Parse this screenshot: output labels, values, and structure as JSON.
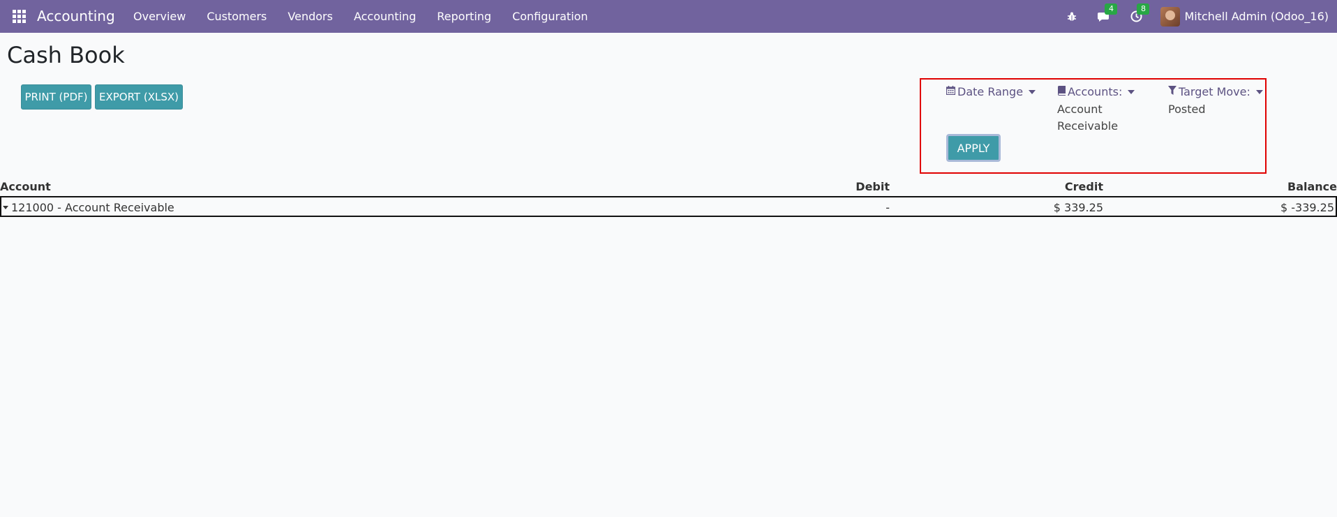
{
  "navbar": {
    "app_name": "Accounting",
    "menu": [
      "Overview",
      "Customers",
      "Vendors",
      "Accounting",
      "Reporting",
      "Configuration"
    ],
    "messages_count": "4",
    "activities_count": "8",
    "user_name": "Mitchell Admin (Odoo_16)"
  },
  "page": {
    "title": "Cash Book",
    "print_label": "PRINT (PDF)",
    "export_label": "EXPORT (XLSX)"
  },
  "filters": {
    "date_range_label": "Date Range",
    "accounts_label": "Accounts:",
    "accounts_value": "Account Receivable",
    "target_move_label": "Target Move:",
    "target_move_value": "Posted",
    "apply_label": "APPLY"
  },
  "table": {
    "headers": {
      "account": "Account",
      "debit": "Debit",
      "credit": "Credit",
      "balance": "Balance"
    },
    "rows": [
      {
        "account": "121000 - Account Receivable",
        "debit": "-",
        "credit": "$ 339.25",
        "balance": "$ -339.25"
      }
    ]
  },
  "colors": {
    "navbar": "#71639e",
    "button": "#3f9ba8",
    "highlight_border": "#e00000",
    "badge": "#28a745"
  }
}
